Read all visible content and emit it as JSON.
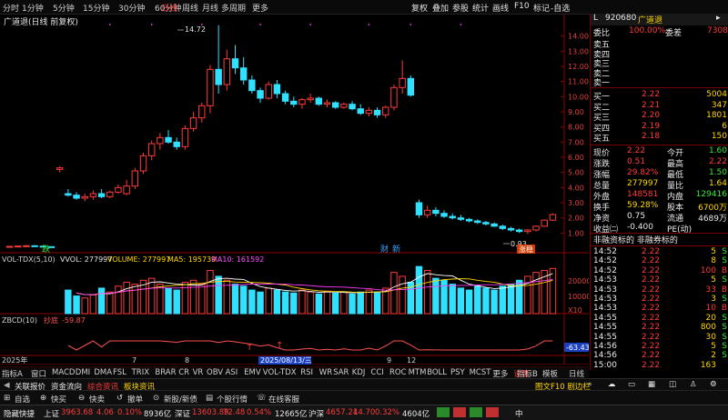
{
  "period_tabs": [
    "分时",
    "1分钟",
    "5分钟",
    "15分钟",
    "30分钟",
    "60分钟",
    "日线",
    "周线",
    "月线",
    "多周期",
    "更多"
  ],
  "right_toolbar": [
    "复权",
    "叠加",
    "参股",
    "统计",
    "画线",
    "F10",
    "标记",
    "-自选"
  ],
  "chart": {
    "title": "广道退(日线 前复权)",
    "high_label": "14.72",
    "low_label": "0.93",
    "marker_die": "跌",
    "marker_cai": "财",
    "marker_xin": "新",
    "marker_tiao": "涨稳",
    "y_ticks": [
      "14.00",
      "13.00",
      "12.00",
      "11.00",
      "10.00",
      "9.00",
      "8.00",
      "7.00",
      "6.00",
      "5.00",
      "4.00",
      "3.00",
      "2.00",
      "1.00"
    ]
  },
  "chart_data": {
    "type": "candlestick",
    "candles": [
      [
        0.1,
        0.15,
        0.05,
        0.12
      ],
      [
        0.12,
        0.18,
        0.08,
        0.14
      ],
      [
        0.14,
        0.2,
        0.1,
        0.16
      ],
      [
        0.16,
        0.2,
        0.12,
        0.13
      ],
      [
        0.13,
        0.16,
        0.08,
        0.1
      ],
      [
        0.1,
        0.12,
        0.04,
        0.06
      ],
      [
        5.2,
        5.4,
        5.0,
        5.3
      ],
      [
        3.6,
        3.9,
        3.4,
        3.5
      ],
      [
        3.5,
        3.7,
        3.2,
        3.3
      ],
      [
        3.3,
        3.6,
        3.1,
        3.4
      ],
      [
        3.4,
        3.8,
        3.2,
        3.6
      ],
      [
        3.6,
        3.9,
        3.3,
        3.4
      ],
      [
        3.4,
        3.8,
        3.3,
        3.7
      ],
      [
        3.7,
        4.2,
        3.6,
        4.0
      ],
      [
        3.6,
        4.5,
        3.5,
        4.1
      ],
      [
        4.1,
        5.3,
        3.9,
        5.1
      ],
      [
        5.1,
        6.3,
        4.9,
        6.1
      ],
      [
        6.1,
        7.1,
        5.8,
        6.9
      ],
      [
        6.9,
        7.6,
        6.5,
        7.3
      ],
      [
        7.3,
        7.8,
        6.9,
        7.0
      ],
      [
        7.0,
        7.3,
        6.5,
        6.7
      ],
      [
        6.7,
        8.1,
        6.5,
        7.9
      ],
      [
        7.9,
        9.0,
        7.7,
        8.6
      ],
      [
        8.6,
        9.6,
        8.3,
        9.4
      ],
      [
        9.4,
        12.1,
        8.9,
        11.8
      ],
      [
        11.8,
        14.72,
        10.2,
        10.8
      ],
      [
        10.8,
        13.1,
        10.4,
        12.5
      ],
      [
        12.5,
        13.4,
        11.5,
        11.9
      ],
      [
        11.9,
        12.6,
        10.8,
        11.1
      ],
      [
        11.1,
        11.4,
        10.2,
        10.4
      ],
      [
        10.4,
        10.6,
        9.6,
        9.9
      ],
      [
        9.9,
        11.0,
        9.8,
        10.8
      ],
      [
        10.8,
        11.1,
        9.9,
        10.2
      ],
      [
        10.2,
        10.4,
        9.5,
        9.7
      ],
      [
        9.7,
        10.0,
        9.3,
        9.5
      ],
      [
        9.5,
        9.9,
        9.2,
        9.8
      ],
      [
        9.8,
        10.2,
        9.6,
        9.9
      ],
      [
        9.9,
        10.0,
        9.4,
        9.5
      ],
      [
        9.5,
        9.8,
        9.3,
        9.6
      ],
      [
        9.6,
        9.7,
        9.2,
        9.3
      ],
      [
        9.3,
        9.6,
        9.2,
        9.5
      ],
      [
        9.5,
        9.7,
        9.1,
        9.2
      ],
      [
        9.2,
        9.5,
        8.8,
        8.9
      ],
      [
        8.9,
        9.3,
        8.7,
        9.1
      ],
      [
        9.1,
        9.3,
        8.6,
        8.8
      ],
      [
        8.8,
        9.4,
        8.6,
        9.3
      ],
      [
        9.3,
        10.8,
        9.1,
        10.6
      ],
      [
        10.6,
        12.4,
        10.2,
        11.2
      ],
      [
        11.2,
        11.4,
        10.0,
        10.1
      ],
      [
        3.0,
        3.2,
        2.0,
        2.2
      ],
      [
        2.2,
        2.8,
        2.0,
        2.5
      ],
      [
        2.5,
        2.7,
        2.1,
        2.3
      ],
      [
        2.3,
        2.5,
        2.0,
        2.1
      ],
      [
        2.1,
        2.3,
        1.9,
        2.0
      ],
      [
        2.0,
        2.2,
        1.8,
        1.9
      ],
      [
        1.9,
        2.0,
        1.7,
        1.8
      ],
      [
        1.8,
        1.9,
        1.6,
        1.7
      ],
      [
        1.7,
        1.8,
        1.5,
        1.6
      ],
      [
        1.6,
        1.7,
        1.4,
        1.45
      ],
      [
        1.45,
        1.55,
        1.2,
        1.3
      ],
      [
        1.3,
        1.4,
        1.1,
        1.2
      ],
      [
        1.2,
        1.3,
        1.0,
        1.1
      ],
      [
        1.1,
        1.25,
        0.93,
        1.2
      ],
      [
        1.2,
        1.5,
        1.1,
        1.45
      ],
      [
        1.45,
        1.9,
        1.4,
        1.85
      ],
      [
        1.85,
        2.3,
        1.8,
        2.22
      ]
    ],
    "volumes": [
      0,
      0,
      0,
      0,
      0,
      0,
      0,
      12000,
      9000,
      8000,
      9500,
      13000,
      11000,
      14000,
      16000,
      15000,
      17000,
      18000,
      15000,
      13000,
      12000,
      16000,
      17000,
      15000,
      22000,
      19000,
      17000,
      15000,
      14000,
      12000,
      11000,
      13000,
      12000,
      11000,
      10500,
      12000,
      11000,
      10000,
      11500,
      10500,
      11000,
      10000,
      11000,
      12000,
      11000,
      13000,
      21000,
      19000,
      16000,
      24000,
      22000,
      18000,
      17000,
      15000,
      13000,
      12000,
      14000,
      13000,
      12000,
      14000,
      15000,
      17000,
      19000,
      21000,
      22000,
      23000
    ],
    "ma_price_range": [
      0,
      15
    ]
  },
  "vol_indicator": {
    "name": "VOL-TDX(5,10)",
    "vvol_label": "VVOL: 277997",
    "volume_label": "VOLUME: 277997",
    "ma5_label": "MA5: 195739",
    "ma10_label": "MA10: 161592",
    "tick_20000": "20000",
    "tick_10000": "10000",
    "unit": "X10"
  },
  "zbcd": {
    "name": "ZBCD(10)",
    "label": "抄底",
    "value": "-59.87",
    "current": "-63.43"
  },
  "x_axis": {
    "year": "2025年",
    "labels": [
      "7",
      "8",
      "9",
      "12"
    ],
    "highlight_date": "2025/08/13/三"
  },
  "indicator_tabs": [
    "指标A",
    "窗口",
    "MACD",
    "DMI",
    "DMA",
    "FSL",
    "TRIX",
    "BRAR",
    "CR",
    "VR",
    "OBV",
    "ASI",
    "EMV",
    "VOL-TDX",
    "RSI",
    "WR",
    "SAR",
    "KDJ",
    "CCI",
    "ROC",
    "MTM",
    "BOLL",
    "PSY",
    "MCST",
    "更多",
    "设置"
  ],
  "indicator_tabs_right": [
    "指标B",
    "模板",
    "日线"
  ],
  "quote": {
    "code": "920680",
    "name": "广道退",
    "weibi_label": "委比",
    "weibi_value": "100.00%",
    "weicha_label": "委差",
    "weicha_value": "7308",
    "sell_labels": [
      "卖五",
      "卖四",
      "卖三",
      "卖二",
      "卖一"
    ],
    "buy": [
      {
        "label": "买一",
        "price": "2.22",
        "vol": "5004"
      },
      {
        "label": "买二",
        "price": "2.21",
        "vol": "347"
      },
      {
        "label": "买三",
        "price": "2.20",
        "vol": "1801"
      },
      {
        "label": "买四",
        "price": "2.19",
        "vol": "6"
      },
      {
        "label": "买五",
        "price": "2.18",
        "vol": "150"
      }
    ],
    "stats": [
      {
        "l1": "现价",
        "v1": "2.22",
        "l2": "今开",
        "v2": "1.60"
      },
      {
        "l1": "涨跌",
        "v1": "0.51",
        "l2": "最高",
        "v2": "2.22"
      },
      {
        "l1": "涨幅",
        "v1": "29.82%",
        "l2": "最低",
        "v2": "1.50"
      },
      {
        "l1": "总量",
        "v1": "277997",
        "l2": "量比",
        "v2": "1.64"
      },
      {
        "l1": "外盘",
        "v1": "148581",
        "l2": "内盘",
        "v2": "129416"
      },
      {
        "l1": "换手",
        "v1": "59.28%",
        "l2": "股本",
        "v2": "6700万"
      },
      {
        "l1": "净资",
        "v1": "0.75",
        "l2": "流通",
        "v2": "4689万"
      },
      {
        "l1": "收益㈡",
        "v1": "-0.400",
        "l2": "PE(动)",
        "v2": ""
      }
    ],
    "margin_note": "非融资标的 非融券标的",
    "ticks": [
      {
        "t": "14:52",
        "p": "2.22",
        "v": "5"
      },
      {
        "t": "14:52",
        "p": "2.22",
        "v": "8"
      },
      {
        "t": "14:52",
        "p": "2.22",
        "v": "100"
      },
      {
        "t": "14:53",
        "p": "2.22",
        "v": "5"
      },
      {
        "t": "14:53",
        "p": "2.22",
        "v": "33"
      },
      {
        "t": "14:53",
        "p": "2.22",
        "v": "3"
      },
      {
        "t": "14:53",
        "p": "2.22",
        "v": "10"
      },
      {
        "t": "14:55",
        "p": "2.22",
        "v": "20"
      },
      {
        "t": "14:55",
        "p": "2.22",
        "v": "800"
      },
      {
        "t": "14:55",
        "p": "2.22",
        "v": "30"
      },
      {
        "t": "14:56",
        "p": "2.22",
        "v": "5"
      },
      {
        "t": "14:56",
        "p": "2.22",
        "v": "2"
      },
      {
        "t": "15:00",
        "p": "2.22",
        "v": "163"
      }
    ],
    "tick_flags": [
      "S",
      "S",
      "B",
      "S",
      "B",
      "S",
      "B",
      "S",
      "S",
      "S",
      "S",
      "S",
      ""
    ]
  },
  "info_tabs": [
    "关联报价",
    "资金流向",
    "综合资讯",
    "板块资讯"
  ],
  "info_right": "图文F10 剧边栏",
  "toolbar": [
    "自选",
    "快买",
    "快卖",
    "撤单",
    "新股/新债",
    "个股行情",
    "在线客服"
  ],
  "status": {
    "hide_label": "隐藏快捷",
    "sh_label": "上证",
    "sh_value": "3963.68",
    "sh_change": "4.06",
    "sh_pct": "0.10%",
    "sh_amount": "8936亿",
    "sz_label": "深证",
    "sz_value": "13603.89",
    "sz_change": "72.48",
    "sz_pct": "0.54%",
    "sz_amount": "12665亿",
    "cy_label": "沪深",
    "cy_value": "4657.24",
    "cy_change": "14.70",
    "cy_pct": "0.32%",
    "cy_amount": "4604亿",
    "ime": "中"
  }
}
